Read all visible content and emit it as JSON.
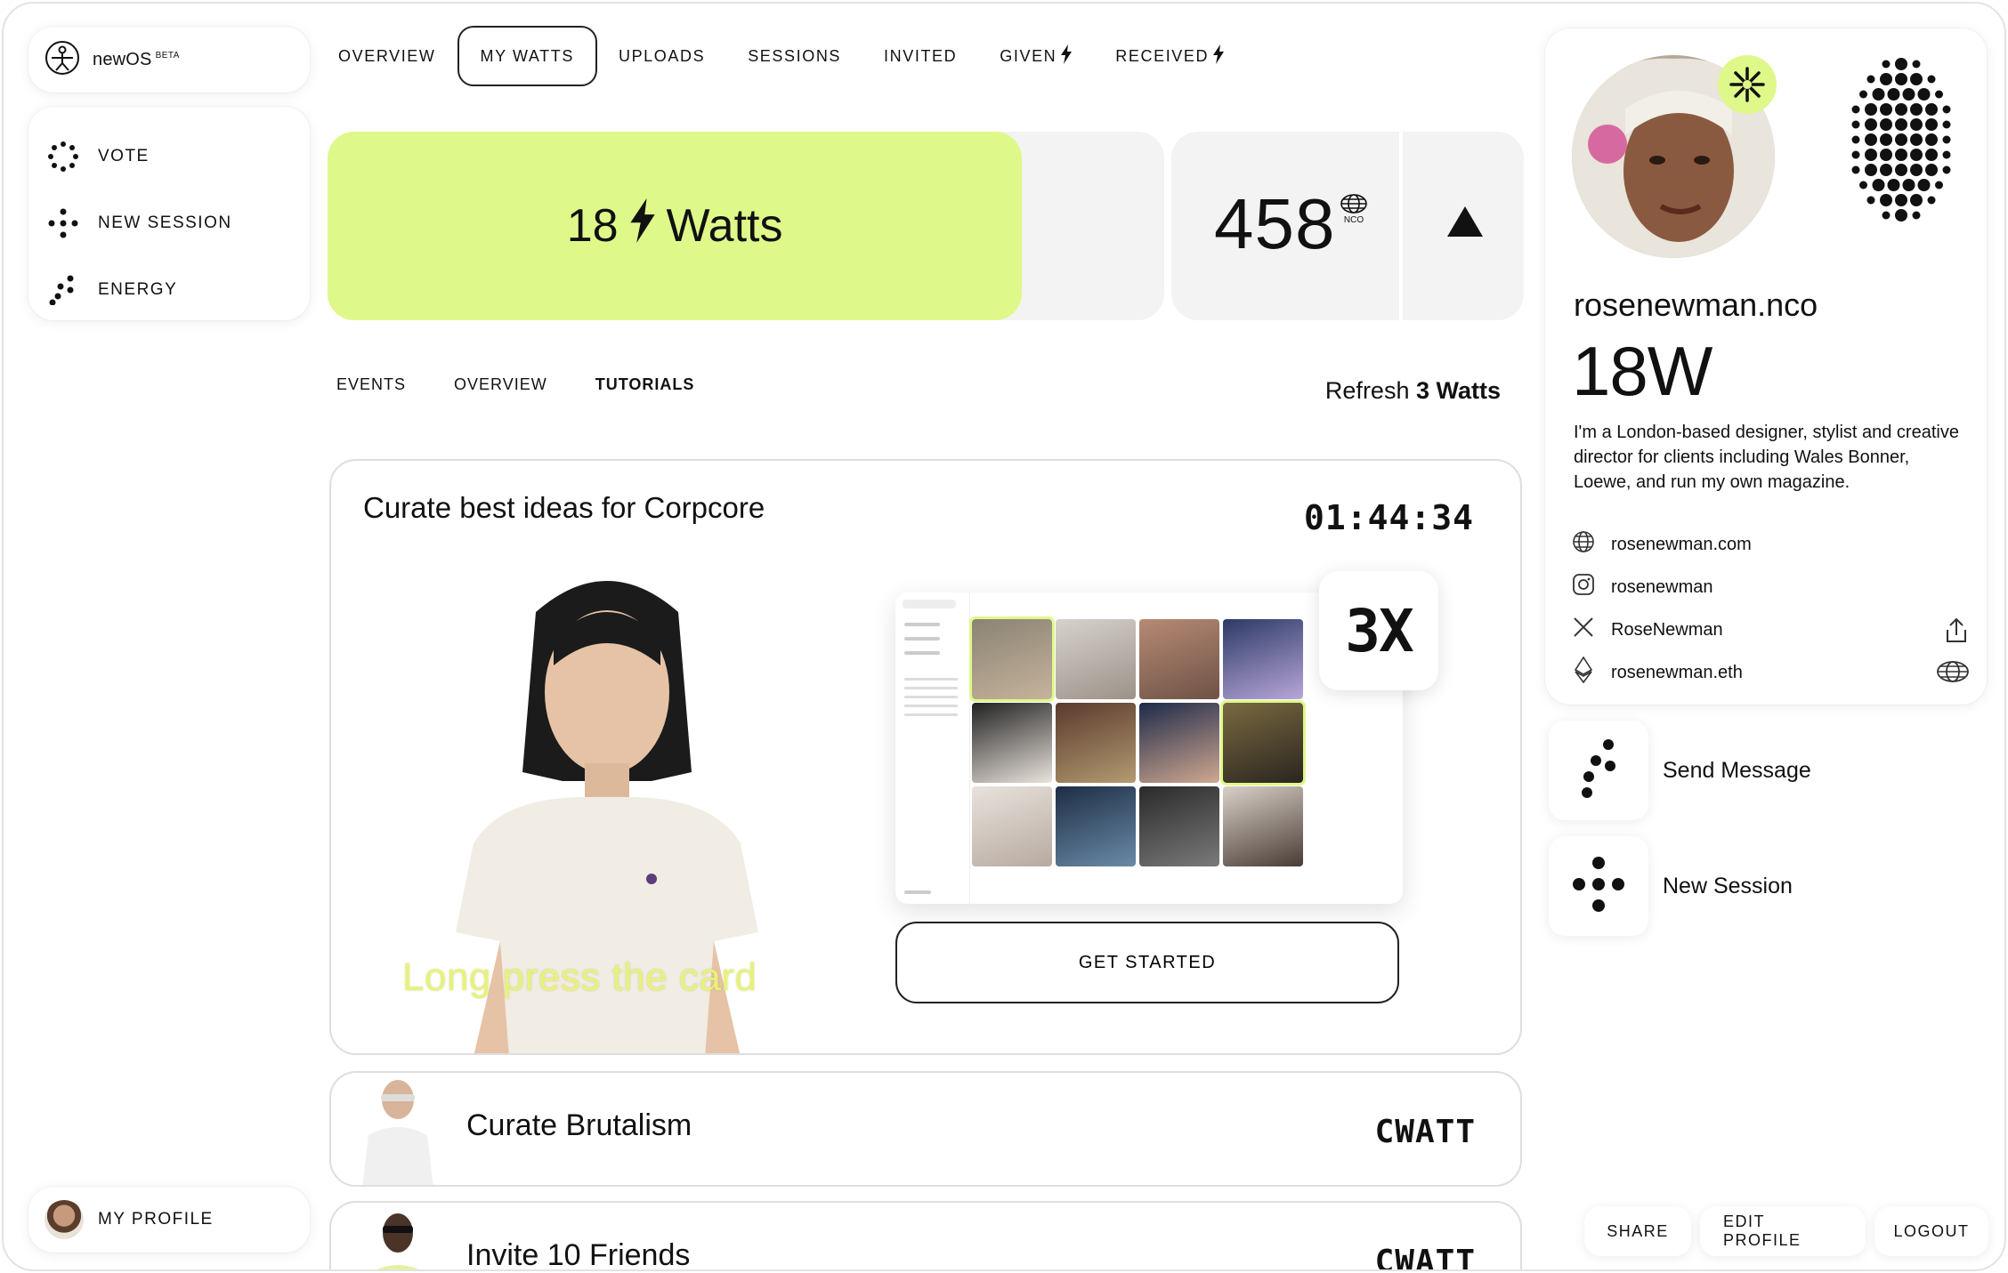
{
  "app": {
    "name": "newOS",
    "badge": "BETA"
  },
  "left_menu": {
    "items": [
      {
        "label": "VOTE",
        "icon": "vote-dots-icon"
      },
      {
        "label": "NEW SESSION",
        "icon": "new-session-dots-icon"
      },
      {
        "label": "ENERGY",
        "icon": "energy-dots-icon"
      }
    ],
    "profile_label": "MY PROFILE"
  },
  "top_tabs": [
    {
      "label": "OVERVIEW",
      "active": false
    },
    {
      "label": "MY WATTS",
      "active": true
    },
    {
      "label": "UPLOADS",
      "active": false
    },
    {
      "label": "SESSIONS",
      "active": false
    },
    {
      "label": "INVITED",
      "active": false
    },
    {
      "label": "GIVEN",
      "active": false,
      "bolt": true
    },
    {
      "label": "RECEIVED",
      "active": false,
      "bolt": true
    }
  ],
  "watts_banner": {
    "value": "18",
    "unit": "Watts",
    "fill_fraction": 0.83,
    "color": "#dff88a"
  },
  "nco": {
    "value": "458",
    "unit": "NCO"
  },
  "sub_tabs": [
    {
      "label": "EVENTS",
      "active": false
    },
    {
      "label": "OVERVIEW",
      "active": false
    },
    {
      "label": "TUTORIALS",
      "active": true
    }
  ],
  "refresh": {
    "prefix": "Refresh",
    "amount": "3 Watts"
  },
  "tutorial": {
    "title": "Curate best ideas for Corpcore",
    "timer": "01:44:34",
    "hint": "Long press the card",
    "multiplier": "3X",
    "cta": "GET STARTED"
  },
  "tasks": [
    {
      "label": "Curate Brutalism",
      "reward": "CWATT"
    },
    {
      "label": "Invite 10 Friends",
      "reward": "CWATT"
    }
  ],
  "profile": {
    "handle": "rosenewman.nco",
    "watts": "18W",
    "bio": "I'm a London-based designer, stylist and creative director for clients including Wales Bonner, Loewe, and run my own magazine.",
    "links": [
      {
        "icon": "globe-icon",
        "text": "rosenewman.com"
      },
      {
        "icon": "instagram-icon",
        "text": "rosenewman"
      },
      {
        "icon": "x-logo-icon",
        "text": "RoseNewman"
      },
      {
        "icon": "ethereum-icon",
        "text": "rosenewman.eth"
      }
    ]
  },
  "actions": [
    {
      "label": "Send Message",
      "icon": "send-message-dots-icon"
    },
    {
      "label": "New Session",
      "icon": "new-session-dots-icon"
    }
  ],
  "footer_buttons": [
    "SHARE",
    "EDIT PROFILE",
    "LOGOUT"
  ]
}
